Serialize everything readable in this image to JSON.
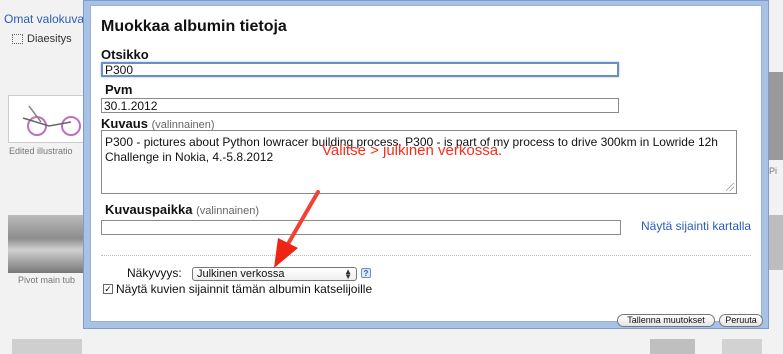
{
  "background": {
    "albums_link": "Omat valokuva",
    "slideshow_label": "Diaesitys",
    "thumb_edited_caption": "Edited illustratio",
    "thumb_pivot_caption": "Pivot main tub",
    "right_caption": "Pi"
  },
  "dialog": {
    "title": "Muokkaa albumin tietoja",
    "title_label": "Otsikko",
    "title_value": "P300",
    "date_label": "Pvm",
    "date_value": "30.1.2012",
    "description_label": "Kuvaus",
    "description_optional": "(valinnainen)",
    "description_value": "P300 - pictures about Python lowracer building process. P300 - is part of my process to drive 300km in Lowride 12h Challenge in Nokia, 4.-5.8.2012",
    "location_label": "Kuvauspaikka",
    "location_optional": "(valinnainen)",
    "location_value": "",
    "map_link": "Näytä sijainti kartalla",
    "visibility_label": "Näkyvyys:",
    "visibility_value": "Julkinen verkossa",
    "help_icon_text": "?",
    "show_locations_label": "Näytä kuvien sijainnit tämän albumin katselijoille",
    "show_locations_checked": true,
    "save_button": "Tallenna muutokset",
    "cancel_button": "Peruuta"
  },
  "annotation": {
    "text": "Valitse > julkinen verkossa.",
    "color": "#ff2a1a"
  },
  "colors": {
    "dialog_border": "#a8c2e6",
    "link": "#2a5db0"
  }
}
